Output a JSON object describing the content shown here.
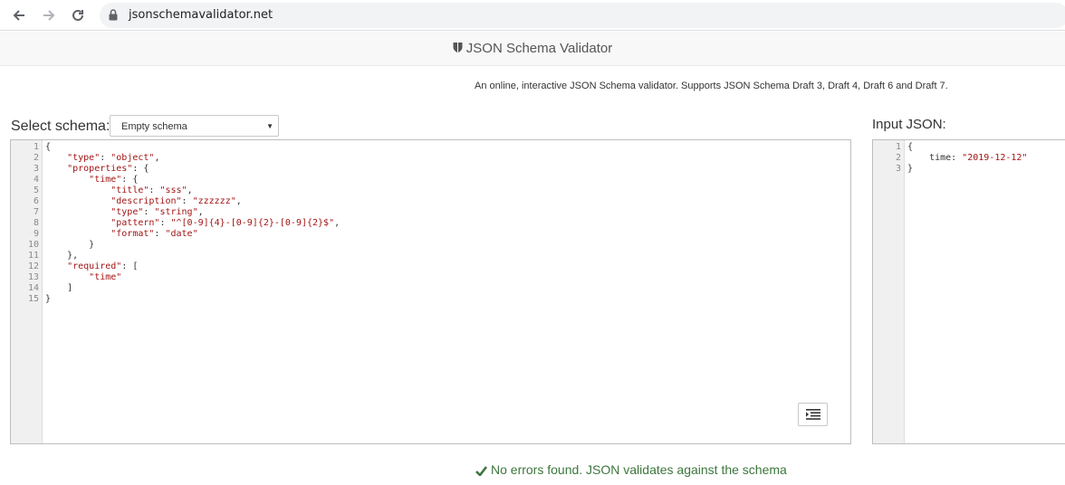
{
  "browser": {
    "url": "jsonschemavalidator.net"
  },
  "site": {
    "title": "JSON Schema Validator",
    "tagline": "An online, interactive JSON Schema validator. Supports JSON Schema Draft 3, Draft 4, Draft 6 and Draft 7."
  },
  "schema_panel": {
    "label": "Select schema:",
    "selected": "Empty schema",
    "line_numbers": [
      "1",
      "2",
      "3",
      "4",
      "5",
      "6",
      "7",
      "8",
      "9",
      "10",
      "11",
      "12",
      "13",
      "14",
      "15"
    ],
    "lines": [
      "{",
      "    \"type\": \"object\",",
      "    \"properties\": {",
      "        \"time\": {",
      "            \"title\": \"sss\",",
      "            \"description\": \"zzzzzz\",",
      "            \"type\": \"string\",",
      "            \"pattern\": \"^[0-9]{4}-[0-9]{2}-[0-9]{2}$\",",
      "            \"format\": \"date\"",
      "        }",
      "    },",
      "    \"required\": [",
      "        \"time\"",
      "    ]",
      "}"
    ]
  },
  "input_panel": {
    "label": "Input JSON:",
    "line_numbers": [
      "1",
      "2",
      "3"
    ],
    "lines": [
      "{",
      "    time: \"2019-12-12\"",
      "}"
    ]
  },
  "status": {
    "message": "No errors found. JSON validates against the schema",
    "color": "#3c763d"
  },
  "icons": [
    "back-arrow-icon",
    "forward-arrow-icon",
    "reload-icon",
    "lock-icon",
    "shield-icon",
    "format-icon",
    "check-icon"
  ]
}
